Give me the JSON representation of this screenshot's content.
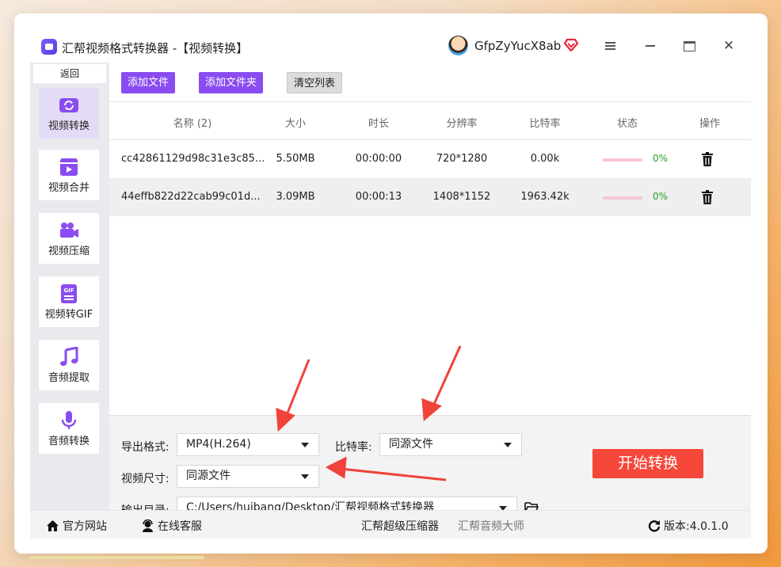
{
  "app": {
    "title": "汇帮视频格式转换器 -【视频转换】",
    "username": "GfpZyYucX8ab"
  },
  "sidebar": {
    "back_label": "返回",
    "items": [
      {
        "label": "视频转换",
        "icon": "video-convert-icon",
        "active": true
      },
      {
        "label": "视频合并",
        "icon": "video-merge-icon",
        "active": false
      },
      {
        "label": "视频压缩",
        "icon": "video-compress-icon",
        "active": false
      },
      {
        "label": "视频转GIF",
        "icon": "gif-icon",
        "active": false
      },
      {
        "label": "音频提取",
        "icon": "music-note-icon",
        "active": false
      },
      {
        "label": "音频转换",
        "icon": "microphone-icon",
        "active": false
      }
    ]
  },
  "toolbar": {
    "add_file": "添加文件",
    "add_folder": "添加文件夹",
    "clear_list": "清空列表"
  },
  "table": {
    "headers": [
      "名称 (2)",
      "大小",
      "时长",
      "分辨率",
      "比特率",
      "状态",
      "操作"
    ],
    "rows": [
      {
        "name": "cc42861129d98c31e3c85...",
        "size": "5.50MB",
        "duration": "00:00:00",
        "resolution": "720*1280",
        "bitrate": "0.00k",
        "progress": "0%"
      },
      {
        "name": "44effb822d22cab99c01d...",
        "size": "3.09MB",
        "duration": "00:00:13",
        "resolution": "1408*1152",
        "bitrate": "1963.42k",
        "progress": "0%"
      }
    ]
  },
  "settings": {
    "export_format_label": "导出格式:",
    "export_format_value": "MP4(H.264)",
    "bitrate_label": "比特率:",
    "bitrate_value": "同源文件",
    "video_size_label": "视频尺寸:",
    "video_size_value": "同源文件",
    "output_dir_label": "输出目录:",
    "output_dir_value": "C:/Users/huibang/Desktop/汇帮视频格式转换器",
    "start_label": "开始转换"
  },
  "footer": {
    "website": "官方网站",
    "support": "在线客服",
    "compressor": "汇帮超级压缩器",
    "audio_master": "汇帮音频大师",
    "version": "版本:4.0.1.0"
  },
  "colors": {
    "accent_purple": "#8a4cf0",
    "start_red": "#f5473a",
    "progress_pink": "#f7c6d6",
    "percent_green": "#2aa12a"
  }
}
